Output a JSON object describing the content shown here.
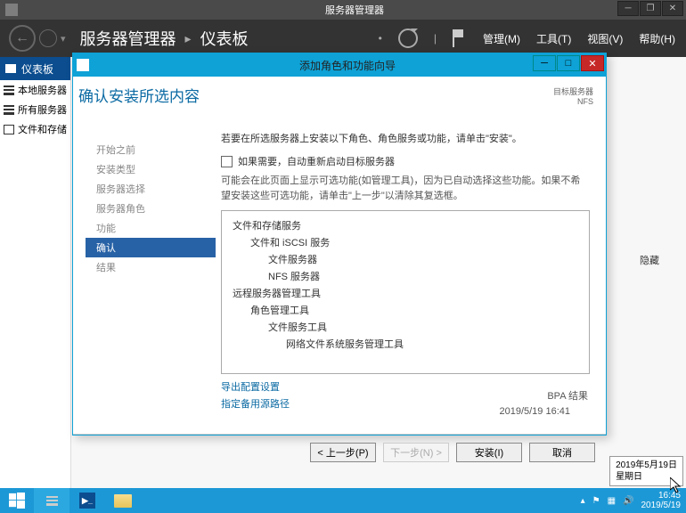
{
  "window": {
    "title": "服务器管理器"
  },
  "header": {
    "breadcrumb_root": "服务器管理器",
    "breadcrumb_leaf": "仪表板",
    "menus": {
      "manage": "管理(M)",
      "tools": "工具(T)",
      "view": "视图(V)",
      "help": "帮助(H)"
    }
  },
  "sidebar": {
    "header": "仪表板",
    "items": [
      {
        "label": "本地服务器"
      },
      {
        "label": "所有服务器"
      },
      {
        "label": "文件和存储"
      }
    ]
  },
  "wizard": {
    "title": "添加角色和功能向导",
    "heading": "确认安装所选内容",
    "target_label": "目标服务器",
    "target_value": "NFS",
    "steps": [
      "开始之前",
      "安装类型",
      "服务器选择",
      "服务器角色",
      "功能",
      "确认",
      "结果"
    ],
    "active_step": 5,
    "intro": "若要在所选服务器上安装以下角色、角色服务或功能，请单击\"安装\"。",
    "checkbox_label": "如果需要，自动重新启动目标服务器",
    "note": "可能会在此页面上显示可选功能(如管理工具)，因为已自动选择这些功能。如果不希望安装这些可选功能，请单击\"上一步\"以清除其复选框。",
    "tree": [
      {
        "l": 0,
        "t": "文件和存储服务"
      },
      {
        "l": 1,
        "t": "文件和 iSCSI 服务"
      },
      {
        "l": 2,
        "t": "文件服务器"
      },
      {
        "l": 2,
        "t": "NFS 服务器"
      },
      {
        "l": 0,
        "t": "远程服务器管理工具"
      },
      {
        "l": 1,
        "t": "角色管理工具"
      },
      {
        "l": 2,
        "t": "文件服务工具"
      },
      {
        "l": 3,
        "t": "网络文件系统服务管理工具"
      }
    ],
    "links": {
      "export": "导出配置设置",
      "altpath": "指定备用源路径"
    },
    "buttons": {
      "prev": "< 上一步(P)",
      "next": "下一步(N) >",
      "install": "安装(I)",
      "cancel": "取消"
    }
  },
  "background": {
    "bpa_title": "BPA 结果",
    "bpa_time": "2019/5/19 16:41",
    "hide_label": "隐藏"
  },
  "tooltip": {
    "line1": "2019年5月19日",
    "line2": "星期日"
  },
  "taskbar": {
    "time": "16:45",
    "date": "2019/5/19"
  }
}
